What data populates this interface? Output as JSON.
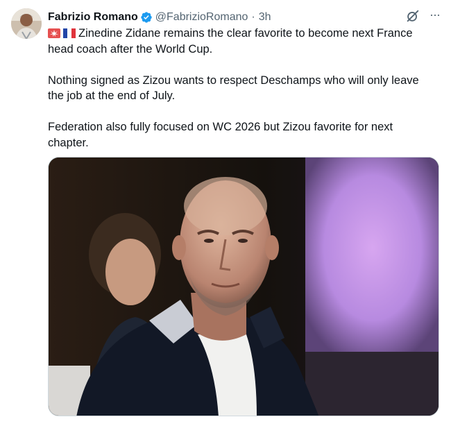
{
  "tweet": {
    "author_name": "Fabrizio Romano",
    "handle": "@FabrizioRomano",
    "time": "3h",
    "separator": "·",
    "more_label": "···",
    "line1": "Zinedine Zidane remains the clear favorite to become next France head coach after the World Cup.",
    "para2": "Nothing signed as Zizou wants to respect Deschamps who will only leave the job at the end of July.",
    "para3": "Federation also fully focused on WC 2026 but Zizou favorite for next chapter.",
    "icons": [
      "verified-badge-icon",
      "grok-icon",
      "more-icon",
      "siren-emoji",
      "france-flag-emoji"
    ],
    "colors": {
      "verified": "#1d9bf0",
      "text": "#0f1419",
      "muted": "#536471"
    }
  }
}
